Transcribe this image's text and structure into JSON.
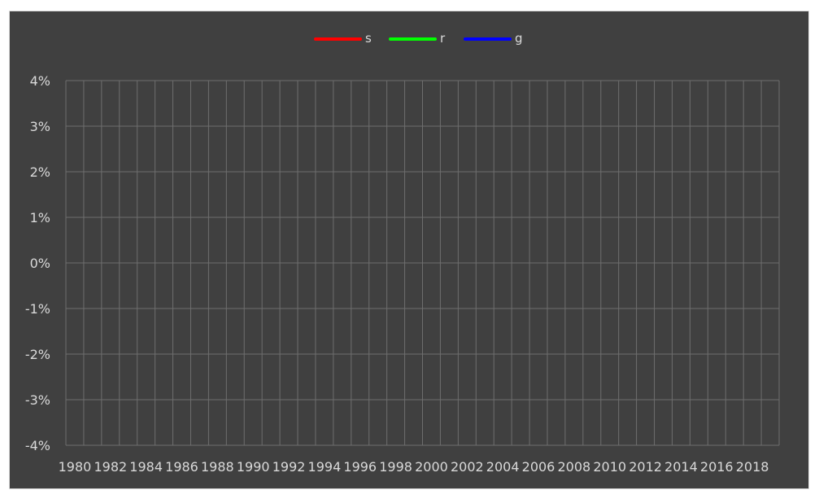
{
  "chart_data": {
    "type": "line",
    "title": "",
    "xlabel": "",
    "ylabel": "",
    "x": [
      1980,
      1981,
      1982,
      1983,
      1984,
      1985,
      1986,
      1987,
      1988,
      1989,
      1990,
      1991,
      1992,
      1993,
      1994,
      1995,
      1996,
      1997,
      1998,
      1999,
      2000,
      2001,
      2002,
      2003,
      2004,
      2005,
      2006,
      2007,
      2008,
      2009,
      2010,
      2011,
      2012,
      2013,
      2014,
      2015,
      2016,
      2017,
      2018,
      2019
    ],
    "x_tick_labels": [
      "1980",
      "1982",
      "1984",
      "1986",
      "1988",
      "1990",
      "1992",
      "1994",
      "1996",
      "1998",
      "2000",
      "2002",
      "2004",
      "2006",
      "2008",
      "2010",
      "2012",
      "2014",
      "2016",
      "2018"
    ],
    "ylim": [
      -0.04,
      0.04
    ],
    "y_ticks": [
      0.04,
      0.03,
      0.02,
      0.01,
      0.0,
      -0.01,
      -0.02,
      -0.03,
      -0.04
    ],
    "y_tick_labels": [
      "4%",
      "3%",
      "2%",
      "1%",
      "0%",
      "-1%",
      "-2%",
      "-3%",
      "-4%"
    ],
    "grid": true,
    "legend_position": "top-center",
    "background": "#404040",
    "series": [
      {
        "name": "s",
        "color": "#ff0000",
        "values": [
          -0.032,
          -0.032,
          -0.032,
          -0.032,
          -0.032,
          -0.032,
          -0.032,
          -0.032,
          -0.032,
          -0.032,
          -0.032,
          -0.032,
          -0.032,
          -0.032,
          -0.032,
          -0.032,
          -0.032,
          -0.032,
          -0.032,
          -0.032,
          -0.032,
          -0.032,
          -0.032,
          -0.032,
          -0.032,
          -0.032,
          -0.032,
          -0.032,
          -0.032,
          -0.032,
          -0.032,
          -0.032,
          -0.032,
          -0.032,
          -0.032,
          -0.032,
          -0.032,
          -0.032,
          -0.032,
          -0.032
        ]
      },
      {
        "name": "r",
        "color": "#00ff00",
        "values": [
          0.0313,
          0.0313,
          0.0313,
          0.0313,
          0.0313,
          0.0313,
          0.0313,
          0.0313,
          0.0313,
          0.0313,
          0.0313,
          0.0313,
          0.0313,
          0.0313,
          0.0313,
          0.0313,
          0.0313,
          0.0313,
          0.0313,
          0.0313,
          0.0313,
          0.0313,
          0.0313,
          0.0313,
          0.0313,
          0.0313,
          0.0313,
          0.0313,
          0.0313,
          0.0313,
          0.0313,
          0.0313,
          0.0313,
          0.0313,
          0.0313,
          0.0313,
          0.0313,
          0.0313,
          0.0313,
          0.0313
        ]
      },
      {
        "name": "g",
        "color": "#0000ff",
        "values": [
          0.0191,
          0.0191,
          0.0191,
          0.0191,
          0.0191,
          0.0191,
          0.0191,
          0.0191,
          0.0191,
          0.0191,
          0.0191,
          0.0191,
          0.0191,
          0.0191,
          0.0191,
          0.0191,
          0.0191,
          0.0191,
          0.0191,
          0.0191,
          0.0191,
          0.0191,
          0.0191,
          0.0191,
          0.0191,
          0.0191,
          0.0191,
          0.0191,
          0.0191,
          0.0191,
          0.0191,
          0.0191,
          0.0191,
          0.0191,
          0.0191,
          0.0191,
          0.0191,
          0.0191,
          0.0191,
          0.0191
        ]
      }
    ]
  }
}
